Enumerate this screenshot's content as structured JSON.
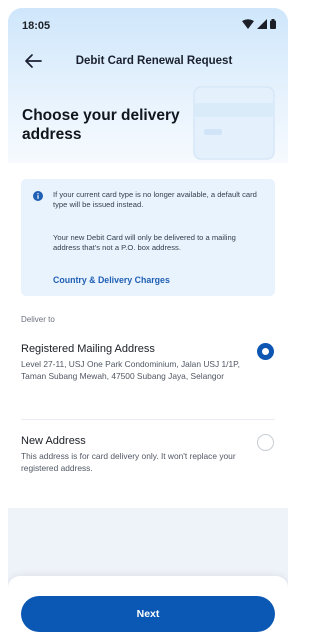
{
  "status_bar": {
    "time": "18:05",
    "icons": [
      "wifi-icon",
      "cell-signal-icon",
      "battery-icon"
    ]
  },
  "header": {
    "title": "Debit Card Renewal Request",
    "back_icon": "arrow-left-icon"
  },
  "page_heading": "Choose your delivery address",
  "info_box": {
    "icon": "info-icon",
    "line_1": "If your current card type is no longer available, a default card type will be issued instead.",
    "line_2": "Your new Debit Card will only be delivered to a mailing address that's not a P.O. box address.",
    "link": "Country & Delivery Charges"
  },
  "deliver_to_label": "Deliver to",
  "options": [
    {
      "title": "Registered Mailing Address",
      "description": "Level 27-11, USJ One Park Condominium, Jalan USJ 1/1P, Taman Subang Mewah, 47500 Subang Jaya, Selangor",
      "selected": true
    },
    {
      "title": "New Address",
      "description": "This address is for card delivery only. It won't replace your registered address.",
      "selected": false
    }
  ],
  "footer": {
    "next_label": "Next"
  },
  "colors": {
    "primary": "#0b58b4",
    "link": "#1f5fb4",
    "info_bg": "#e9f3fd",
    "hero_top": "#cfe6fb"
  }
}
